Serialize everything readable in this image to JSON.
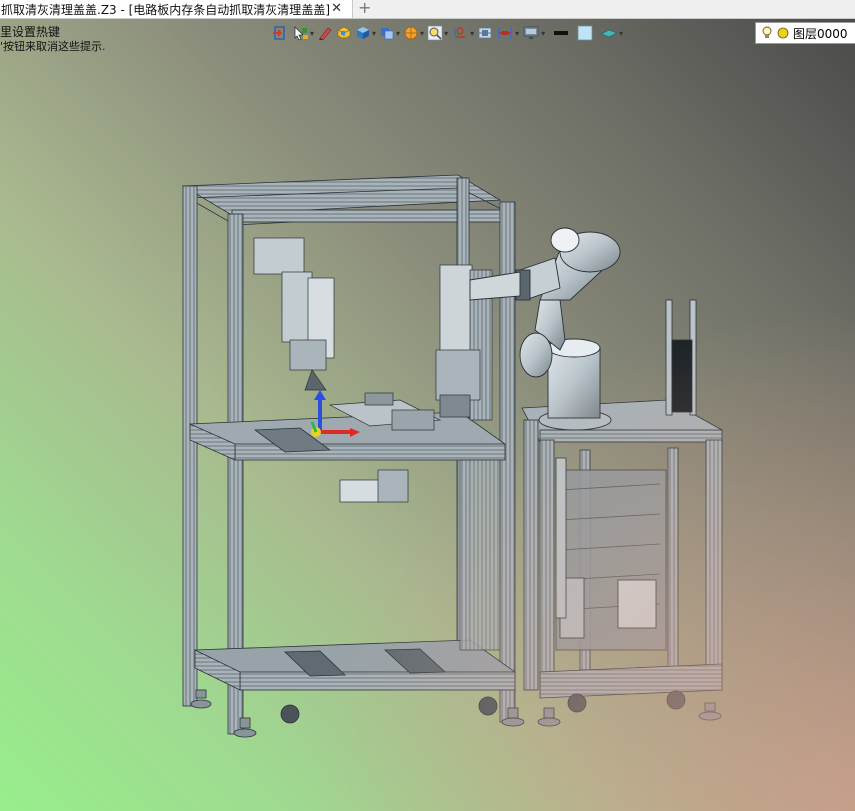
{
  "tab": {
    "title": "抓取清灰清理盖盖.Z3 - [电路板内存条自动抓取清灰清理盖盖]",
    "close_glyph": "✕",
    "new_glyph": "+"
  },
  "hints": {
    "line1": "里设置热键",
    "line2": "'按钮来取消这些提示."
  },
  "toolbar": {
    "icons": [
      {
        "name": "exit-sketch-icon",
        "color": "#d03a2a"
      },
      {
        "name": "pick-filter-icon",
        "color": "#3d8f3a"
      },
      {
        "name": "pen-tool-icon",
        "color": "#c94a4a"
      },
      {
        "name": "box-face-icon",
        "color": "#e0b02a"
      },
      {
        "name": "shaded-cube-icon",
        "color": "#3c8fd6"
      },
      {
        "name": "view-orientation-icon",
        "color": "#3c6fc9"
      },
      {
        "name": "render-mode-icon",
        "color": "#e68a18"
      },
      {
        "name": "zoom-icon",
        "color": "#d7b51e"
      },
      {
        "name": "axis-icon",
        "color": "#c6302a"
      },
      {
        "name": "section-view-icon",
        "color": "#557a9a"
      },
      {
        "name": "measure-icon",
        "color": "#b03030"
      },
      {
        "name": "display-icon",
        "color": "#607080"
      },
      {
        "name": "line-color-icon",
        "color": "#111111"
      },
      {
        "name": "fill-color-icon",
        "color": "#bfe3f2"
      },
      {
        "name": "plane-icon",
        "color": "#4ab5b0"
      }
    ]
  },
  "layer": {
    "label": "图层0000"
  }
}
